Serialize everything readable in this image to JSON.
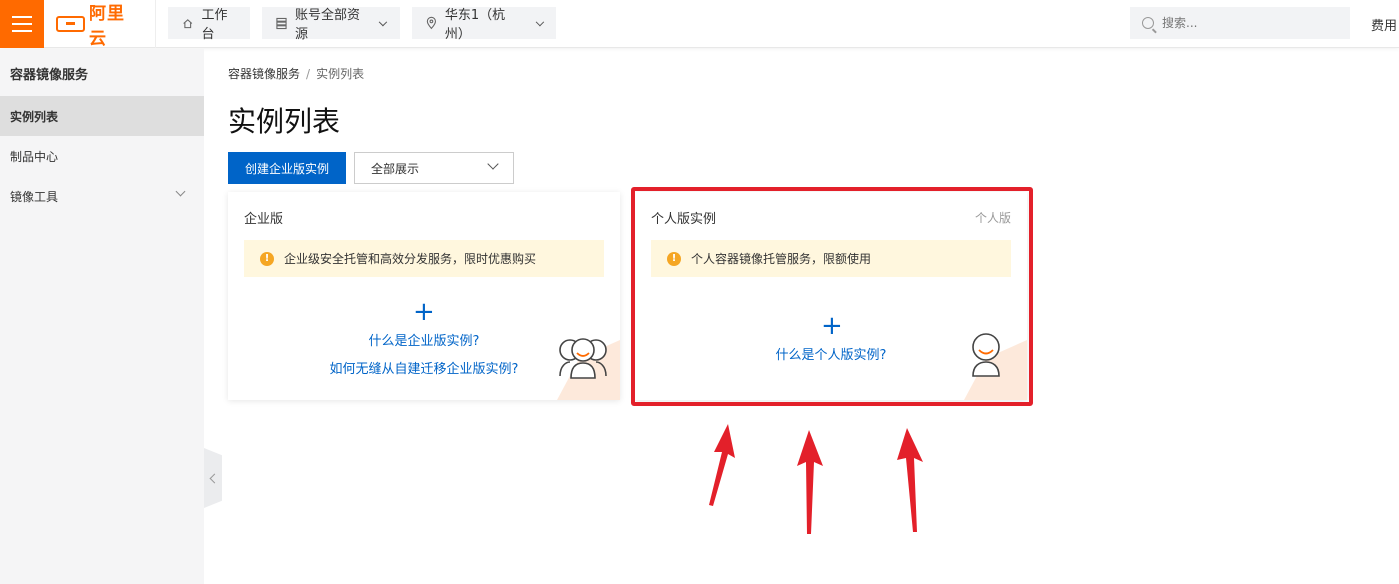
{
  "topbar": {
    "logo_text": "阿里云",
    "workbench": "工作台",
    "account": "账号全部资源",
    "region": "华东1（杭州）",
    "search_placeholder": "搜索...",
    "fee": "费用"
  },
  "sidebar": {
    "title": "容器镜像服务",
    "items": [
      {
        "label": "实例列表"
      },
      {
        "label": "制品中心"
      },
      {
        "label": "镜像工具"
      }
    ]
  },
  "main": {
    "breadcrumb": {
      "root": "容器镜像服务",
      "current": "实例列表"
    },
    "title": "实例列表",
    "create_button": "创建企业版实例",
    "filter_select": "全部展示",
    "cards": {
      "enterprise": {
        "title": "企业版",
        "notice": "企业级安全托管和高效分发服务，限时优惠购买",
        "link1": "什么是企业版实例?",
        "link2": "如何无缝从自建迁移企业版实例?"
      },
      "personal": {
        "title": "个人版实例",
        "tag": "个人版",
        "notice": "个人容器镜像托管服务，限额使用",
        "link1": "什么是个人版实例?"
      }
    }
  },
  "colors": {
    "brand": "#ff6a00",
    "primary": "#0064c8",
    "highlight": "#e3202a"
  }
}
